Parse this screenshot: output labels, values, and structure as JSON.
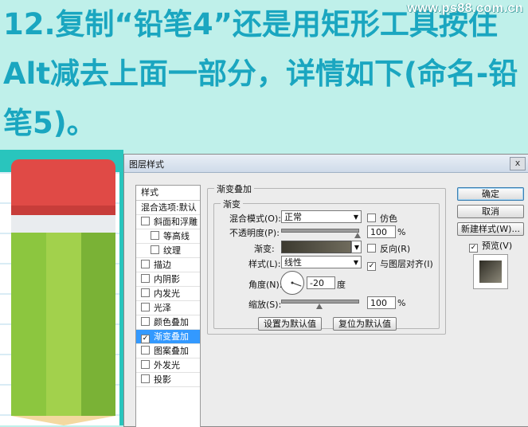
{
  "headline": {
    "line1": "12.复制“铅笔4”还是用矩形工具按住",
    "line2": "Alt减去上面一部分，详情如下(命名-铅",
    "line3": "笔5)。"
  },
  "watermark": "www.ps88.com.cn",
  "dialog": {
    "title": "图层样式",
    "close_label": "x",
    "styles_panel": {
      "header": "样式",
      "items": [
        {
          "label": "混合选项:默认",
          "checkbox": false,
          "checked": false,
          "sub": false,
          "active": false
        },
        {
          "label": "斜面和浮雕",
          "checkbox": true,
          "checked": false,
          "sub": false,
          "active": false
        },
        {
          "label": "等高线",
          "checkbox": true,
          "checked": false,
          "sub": true,
          "active": false
        },
        {
          "label": "纹理",
          "checkbox": true,
          "checked": false,
          "sub": true,
          "active": false
        },
        {
          "label": "描边",
          "checkbox": true,
          "checked": false,
          "sub": false,
          "active": false
        },
        {
          "label": "内阴影",
          "checkbox": true,
          "checked": false,
          "sub": false,
          "active": false
        },
        {
          "label": "内发光",
          "checkbox": true,
          "checked": false,
          "sub": false,
          "active": false
        },
        {
          "label": "光泽",
          "checkbox": true,
          "checked": false,
          "sub": false,
          "active": false
        },
        {
          "label": "颜色叠加",
          "checkbox": true,
          "checked": false,
          "sub": false,
          "active": false
        },
        {
          "label": "渐变叠加",
          "checkbox": true,
          "checked": true,
          "sub": false,
          "active": true
        },
        {
          "label": "图案叠加",
          "checkbox": true,
          "checked": false,
          "sub": false,
          "active": false
        },
        {
          "label": "外发光",
          "checkbox": true,
          "checked": false,
          "sub": false,
          "active": false
        },
        {
          "label": "投影",
          "checkbox": true,
          "checked": false,
          "sub": false,
          "active": false
        }
      ]
    },
    "gradient_overlay": {
      "group_title": "渐变叠加",
      "subgroup_title": "渐变",
      "blend_mode_label": "混合模式(O):",
      "blend_mode_value": "正常",
      "dither_label": "仿色",
      "dither_checked": false,
      "opacity_label": "不透明度(P):",
      "opacity_value": "100",
      "opacity_unit": "%",
      "opacity_level": 1.0,
      "gradient_label": "渐变:",
      "reverse_label": "反向(R)",
      "reverse_checked": false,
      "style_label": "样式(L):",
      "style_value": "线性",
      "align_label": "与图层对齐(I)",
      "align_checked": true,
      "angle_label": "角度(N):",
      "angle_value": "-20",
      "angle_unit": "度",
      "scale_label": "缩放(S):",
      "scale_value": "100",
      "scale_unit": "%",
      "scale_level": 0.5,
      "make_default_label": "设置为默认值",
      "reset_default_label": "复位为默认值"
    },
    "buttons": {
      "ok": "确定",
      "cancel": "取消",
      "new_style": "新建样式(W)...",
      "preview_label": "预览(V)",
      "preview_checked": true
    }
  },
  "colors": {
    "headline": "#1aa6c0",
    "background": "#bff0ea",
    "pencil_red": "#e04a46",
    "pencil_green": "#8cc63f",
    "art_teal": "#29c5bd"
  }
}
